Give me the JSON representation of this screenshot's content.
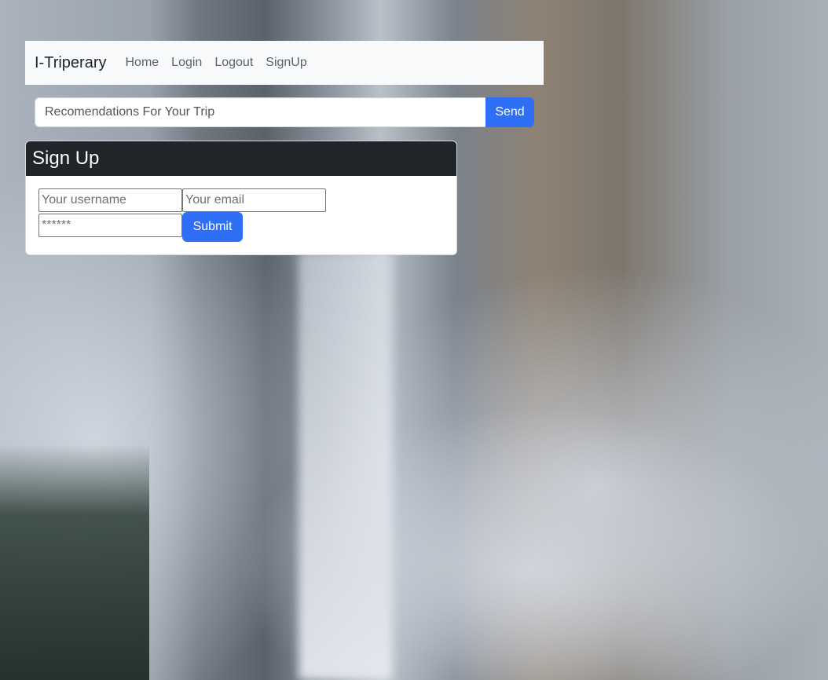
{
  "navbar": {
    "brand": "I-Triperary",
    "links": [
      "Home",
      "Login",
      "Logout",
      "SignUp"
    ]
  },
  "search": {
    "placeholder": "Recomendations For Your Trip",
    "button_label": "Send"
  },
  "signup": {
    "title": "Sign Up",
    "username_placeholder": "Your username",
    "email_placeholder": "Your email",
    "password_placeholder": "******",
    "submit_label": "Submit"
  },
  "colors": {
    "primary": "#2e6ff6",
    "card_header": "#212529",
    "navbar_bg": "#f8f9fa"
  }
}
